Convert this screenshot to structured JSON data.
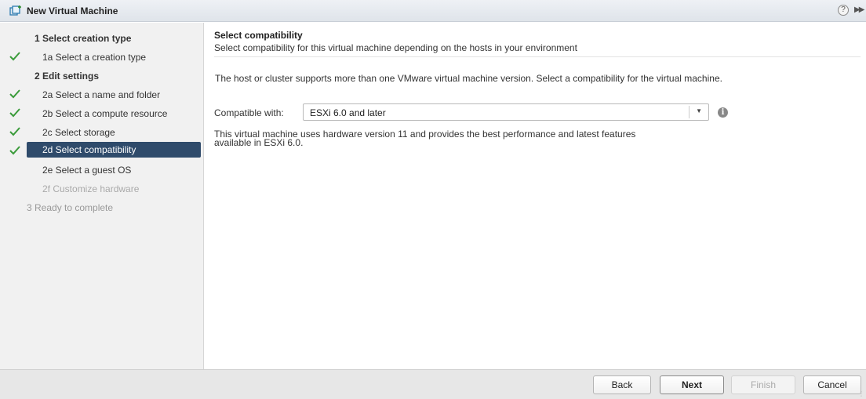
{
  "window": {
    "title": "New Virtual Machine",
    "help_glyph": "?",
    "expand_glyph": "▶▶"
  },
  "sidebar": {
    "steps": [
      {
        "label": "1  Select creation type",
        "level": 1,
        "checked": false,
        "state": "normal"
      },
      {
        "label": "1a  Select a creation type",
        "level": 2,
        "checked": true,
        "state": "normal"
      },
      {
        "label": "2  Edit settings",
        "level": 1,
        "checked": false,
        "state": "normal"
      },
      {
        "label": "2a  Select a name and folder",
        "level": 2,
        "checked": true,
        "state": "normal"
      },
      {
        "label": "2b  Select a compute resource",
        "level": 2,
        "checked": true,
        "state": "normal"
      },
      {
        "label": "2c  Select storage",
        "level": 2,
        "checked": true,
        "state": "normal"
      },
      {
        "label": "2d  Select compatibility",
        "level": 2,
        "checked": true,
        "state": "active"
      },
      {
        "label": "2e  Select a guest OS",
        "level": 2,
        "checked": false,
        "state": "normal"
      },
      {
        "label": "2f  Customize hardware",
        "level": 2,
        "checked": false,
        "state": "disabled"
      },
      {
        "label": "3  Ready to complete",
        "level": 1,
        "checked": false,
        "state": "disabled"
      }
    ]
  },
  "main": {
    "heading": "Select compatibility",
    "subheading": "Select compatibility for this virtual machine depending on the hosts in your environment",
    "intro": "The host or cluster supports more than one VMware virtual machine version. Select a compatibility for the virtual machine.",
    "compat_label": "Compatible with:",
    "compat_value": "ESXi 6.0 and later",
    "desc_line1": "This virtual machine uses hardware version 11 and provides the best performance and latest features",
    "desc_line2": "available in ESXi 6.0."
  },
  "footer": {
    "back": "Back",
    "next": "Next",
    "finish": "Finish",
    "cancel": "Cancel"
  },
  "colors": {
    "check": "#3a9b3a",
    "active_step_bg": "#2f4b6b",
    "sidebar_bg": "#f1f1f1",
    "footer_bg": "#e7e7e7"
  },
  "icons": {
    "title": "vm-new-icon",
    "help": "help-icon",
    "expand": "expand-icon",
    "info": "info-icon",
    "check": "check-icon",
    "dropdown": "chevron-down-icon"
  }
}
